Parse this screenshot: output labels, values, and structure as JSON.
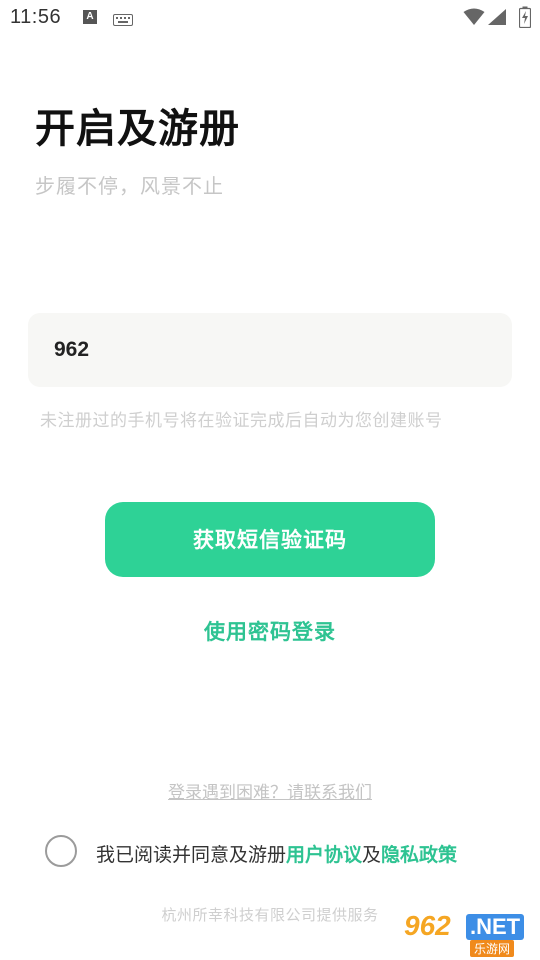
{
  "status_bar": {
    "time": "11:56",
    "icons": [
      "font-a-icon",
      "keyboard-icon",
      "wifi-icon",
      "signal-icon",
      "battery-icon"
    ]
  },
  "header": {
    "title": "开启及游册",
    "subtitle": "步履不停，风景不止"
  },
  "phone_input": {
    "value": "962",
    "hint": "未注册过的手机号将在验证完成后自动为您创建账号"
  },
  "actions": {
    "sms_button_label": "获取短信验证码",
    "password_login_label": "使用密码登录",
    "help_label": "登录遇到困难？请联系我们"
  },
  "agreement": {
    "prefix": "我已阅读并同意及游册",
    "user_agreement": "用户协议",
    "conjunction": "及",
    "privacy_policy": "隐私政策"
  },
  "footer": {
    "text": "杭州所幸科技有限公司提供服务"
  },
  "watermark": {
    "number": "962",
    "suffix": ".NET",
    "cn": "乐游网"
  },
  "colors": {
    "accent": "#2ed296",
    "link": "#2ec392",
    "input_bg": "#f7f7f5"
  }
}
